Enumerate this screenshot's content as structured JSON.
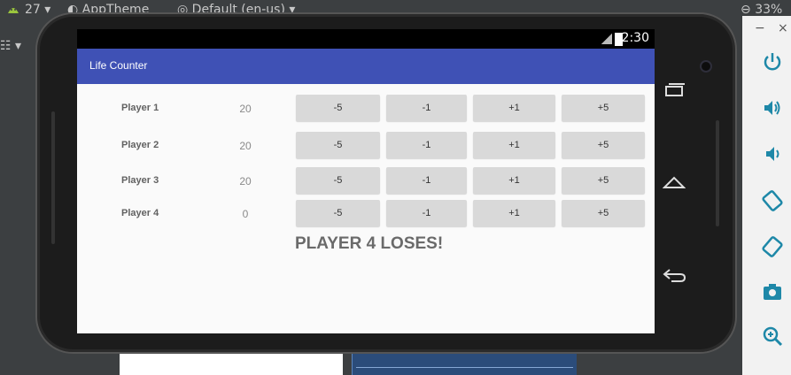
{
  "ide": {
    "api_level": "27",
    "theme": "AppTheme",
    "locale": "Default (en-us)",
    "zoom": "33%"
  },
  "emulator": {
    "controls": {
      "minimize": "−",
      "close": "×"
    },
    "tools": [
      "power-icon",
      "volume-up-icon",
      "volume-down-icon",
      "rotate-left-icon",
      "rotate-right-icon",
      "camera-icon",
      "zoom-icon"
    ]
  },
  "device": {
    "status_time": "2:30",
    "app_title": "Life Counter",
    "players": [
      {
        "name": "Player 1",
        "life": "20"
      },
      {
        "name": "Player 2",
        "life": "20"
      },
      {
        "name": "Player 3",
        "life": "20"
      },
      {
        "name": "Player 4",
        "life": "0"
      }
    ],
    "buttons": {
      "minus5": "-5",
      "minus1": "-1",
      "plus1": "+1",
      "plus5": "+5"
    },
    "message": "PLAYER 4 LOSES!"
  },
  "colors": {
    "appbar": "#3f51b5",
    "button": "#d9d9d9",
    "tool_accent": "#1e88a8"
  }
}
